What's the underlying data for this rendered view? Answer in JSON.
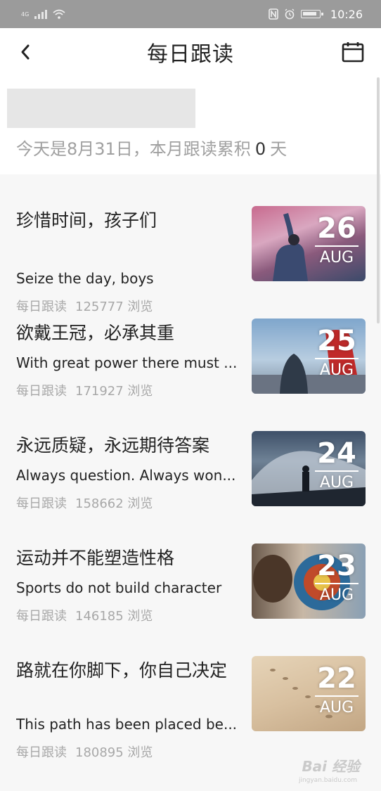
{
  "status_bar": {
    "network": "4G",
    "time": "10:26"
  },
  "nav": {
    "title": "每日跟读",
    "back_icon": "chevron-left-icon",
    "calendar_icon": "calendar-icon"
  },
  "summary": {
    "prefix": "今天是8月31日，本月跟读累积",
    "count": "0",
    "suffix": "天"
  },
  "articles": [
    {
      "title": "珍惜时间，孩子们",
      "subtitle": "Seize the day, boys",
      "source": "每日跟读",
      "views": "125777 浏览",
      "day": "26",
      "month": "AUG"
    },
    {
      "title": "欲戴王冠，必承其重",
      "subtitle": "With great power there must ...",
      "source": "每日跟读",
      "views": "171927 浏览",
      "day": "25",
      "month": "AUG"
    },
    {
      "title": "永远质疑，永远期待答案",
      "subtitle": "Always question. Always won...",
      "source": "每日跟读",
      "views": "158662 浏览",
      "day": "24",
      "month": "AUG"
    },
    {
      "title": "运动并不能塑造性格",
      "subtitle": "Sports do not build character",
      "source": "每日跟读",
      "views": "146185 浏览",
      "day": "23",
      "month": "AUG"
    },
    {
      "title": "路就在你脚下，你自己决定",
      "subtitle": "This path has been placed be...",
      "source": "每日跟读",
      "views": "180895 浏览",
      "day": "22",
      "month": "AUG"
    }
  ],
  "watermark": {
    "text": "Bai 经验",
    "sub": "jingyan.baidu.com"
  }
}
